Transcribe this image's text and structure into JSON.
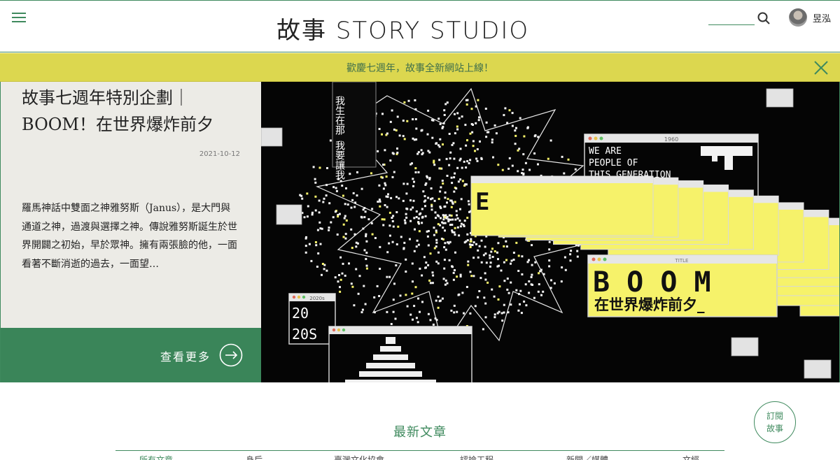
{
  "header": {
    "logo_text": "故事 STORY STUDIO",
    "search_placeholder": "",
    "user_name": "昱泓"
  },
  "announcement": {
    "text": "歡慶七週年，故事全新網站上線！"
  },
  "feature": {
    "title": "故事七週年特別企劃｜BOOM！在世界爆炸前夕",
    "date": "2021-10-12",
    "excerpt": "羅馬神話中雙面之神雅努斯（Janus），是大門與通道之神，過渡與選擇之神。傳說雅努斯誕生於世界開闢之初始，早於眾神。擁有兩張臉的他，一面看著不斷消逝的過去，一面望…",
    "more_label": "查看更多",
    "art": {
      "win_1960_title": "1960",
      "win_1960_lines": [
        "WE ARE",
        "PEOPLE OF",
        "THIS GENERATION"
      ],
      "win_2020_title": "2020s",
      "win_2020_lines": [
        "20",
        "20S"
      ],
      "boom_text": "B O O M",
      "boom_sub": "在世界爆炸前夕_",
      "letters": "EEEEEEEEEEEEE",
      "window_label": "TITLE",
      "vertical_chars": "我生在那 我要讓我"
    }
  },
  "subscribe": {
    "line1": "訂閱",
    "line2": "故事"
  },
  "latest": {
    "title": "最新文章",
    "tabs": [
      "所有文章",
      "身后",
      "臺灣文化協會",
      "評論工程",
      "新聞／媒體",
      "文經"
    ]
  },
  "colors": {
    "brand_green": "#3f8a5e",
    "announce_yellow": "#dcd74f",
    "button_green": "#3a8559",
    "panel_beige": "#ecebe6",
    "art_yellow": "#f6f26a"
  }
}
